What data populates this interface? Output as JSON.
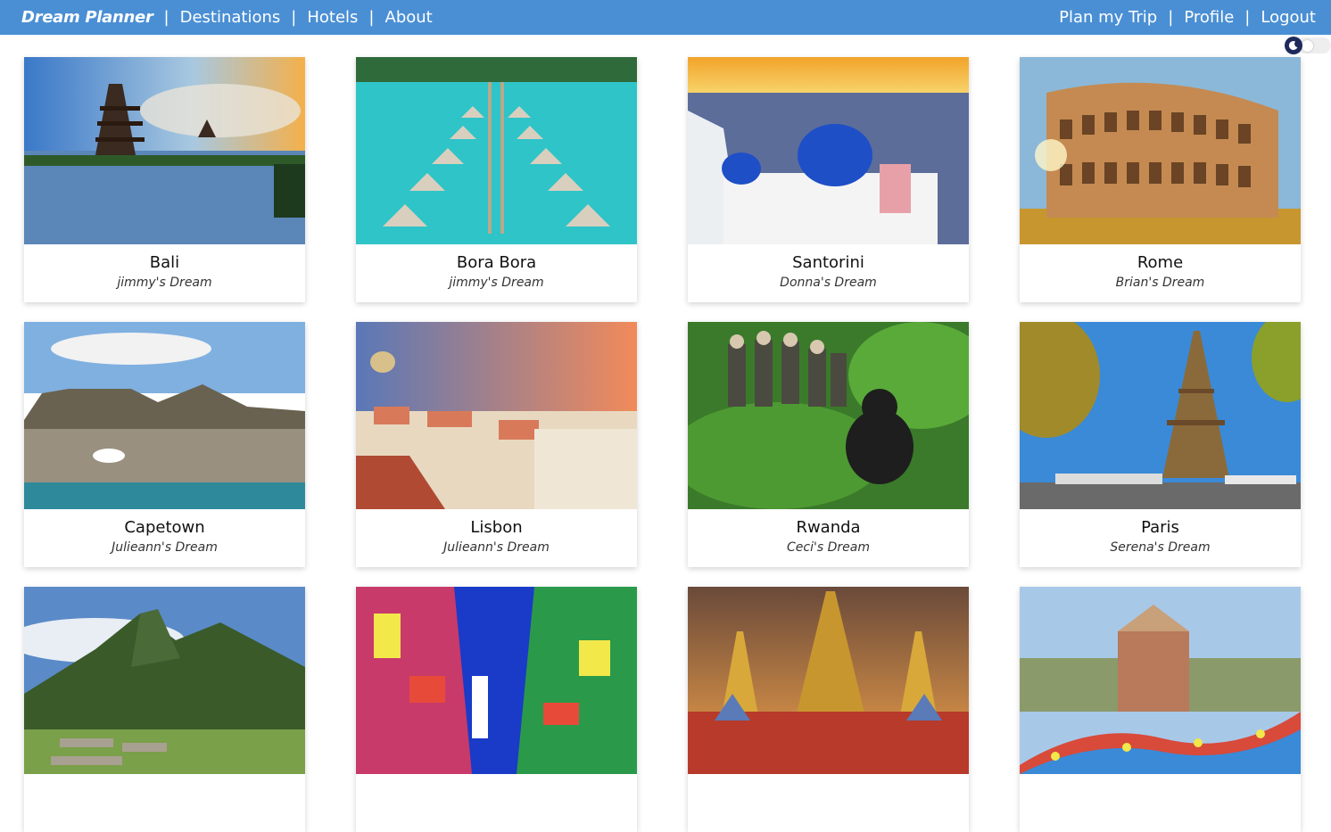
{
  "nav": {
    "brand": "Dream Planner",
    "left_links": [
      "Destinations",
      "Hotels",
      "About"
    ],
    "right_links": [
      "Plan my Trip",
      "Profile",
      "Logout"
    ],
    "separator": "|"
  },
  "theme_toggle": {
    "icon": "moon-icon",
    "state": "off"
  },
  "colors": {
    "navbar": "#4a8fd4"
  },
  "cards": [
    {
      "title": "Bali",
      "subtitle": "jimmy's Dream",
      "image": "bali-temple"
    },
    {
      "title": "Bora Bora",
      "subtitle": "jimmy's Dream",
      "image": "overwater-bungalows"
    },
    {
      "title": "Santorini",
      "subtitle": "Donna's Dream",
      "image": "blue-dome-church"
    },
    {
      "title": "Rome",
      "subtitle": "Brian's Dream",
      "image": "colosseum"
    },
    {
      "title": "Capetown",
      "subtitle": "Julieann's Dream",
      "image": "table-mountain"
    },
    {
      "title": "Lisbon",
      "subtitle": "Julieann's Dream",
      "image": "lisbon-rooftops"
    },
    {
      "title": "Rwanda",
      "subtitle": "Ceci's Dream",
      "image": "gorilla-jungle"
    },
    {
      "title": "Paris",
      "subtitle": "Serena's Dream",
      "image": "eiffel-tower"
    },
    {
      "title": "",
      "subtitle": "",
      "image": "machu-picchu"
    },
    {
      "title": "",
      "subtitle": "",
      "image": "neon-city-street"
    },
    {
      "title": "",
      "subtitle": "",
      "image": "thai-temple"
    },
    {
      "title": "",
      "subtitle": "",
      "image": "mosaic-park"
    }
  ]
}
